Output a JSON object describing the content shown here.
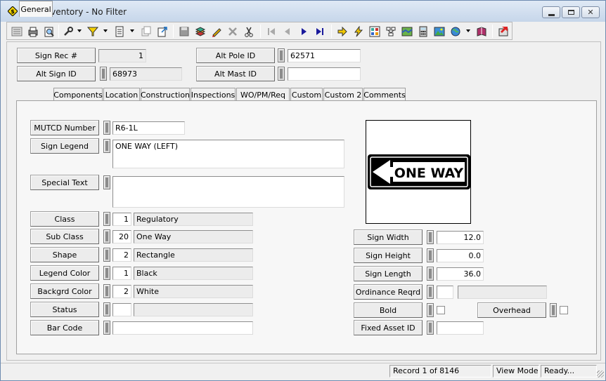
{
  "window": {
    "title": "Sign Inventory - No Filter"
  },
  "toolbar": {
    "icons": [
      "list-view-icon",
      "print-icon",
      "print-preview-icon",
      "tools-icon",
      "filter-icon",
      "report-icon",
      "copy-icon",
      "export-icon",
      "save-icon",
      "layers-icon",
      "edit-pencil-icon",
      "delete-icon",
      "cut-icon",
      "first-record-icon",
      "previous-record-icon",
      "next-record-icon",
      "last-record-icon",
      "go-arrow-icon",
      "lightning-icon",
      "grid-icon",
      "network-icon",
      "map-icon",
      "calculator-icon",
      "image-icon",
      "globe-icon",
      "book-icon",
      "exit-icon"
    ]
  },
  "header": {
    "sign_rec_label": "Sign Rec #",
    "sign_rec_value": "1",
    "alt_sign_id_label": "Alt Sign ID",
    "alt_sign_id_value": "68973",
    "alt_pole_id_label": "Alt Pole ID",
    "alt_pole_id_value": "62571",
    "alt_mast_id_label": "Alt Mast ID",
    "alt_mast_id_value": ""
  },
  "tabs": [
    "General",
    "Components",
    "Location",
    "Construction",
    "Inspections",
    "WO/PM/Req",
    "Custom",
    "Custom 2",
    "Comments"
  ],
  "general": {
    "mutcd_label": "MUTCD Number",
    "mutcd_value": "R6-1L",
    "legend_label": "Sign Legend",
    "legend_value": "ONE WAY (LEFT)",
    "special_label": "Special Text",
    "special_value": "",
    "class_label": "Class",
    "class_code": "1",
    "class_desc": "Regulatory",
    "subclass_label": "Sub Class",
    "subclass_code": "20",
    "subclass_desc": "One Way",
    "shape_label": "Shape",
    "shape_code": "2",
    "shape_desc": "Rectangle",
    "legend_color_label": "Legend Color",
    "legend_color_code": "1",
    "legend_color_desc": "Black",
    "backgrd_color_label": "Backgrd Color",
    "backgrd_color_code": "2",
    "backgrd_color_desc": "White",
    "status_label": "Status",
    "status_code": "",
    "status_desc": "",
    "barcode_label": "Bar Code",
    "barcode_value": "",
    "sign_width_label": "Sign Width",
    "sign_width_value": "12.0",
    "sign_height_label": "Sign Height",
    "sign_height_value": "0.0",
    "sign_length_label": "Sign Length",
    "sign_length_value": "36.0",
    "ordinance_label": "Ordinance Reqrd",
    "ordinance_code": "",
    "ordinance_desc": "",
    "bold_label": "Bold",
    "overhead_label": "Overhead",
    "fixed_asset_label": "Fixed Asset ID",
    "fixed_asset_value": "",
    "sign_image_text": "ONE WAY"
  },
  "status": {
    "record": "Record 1 of 8146",
    "mode": "View Mode",
    "state": "Ready..."
  }
}
